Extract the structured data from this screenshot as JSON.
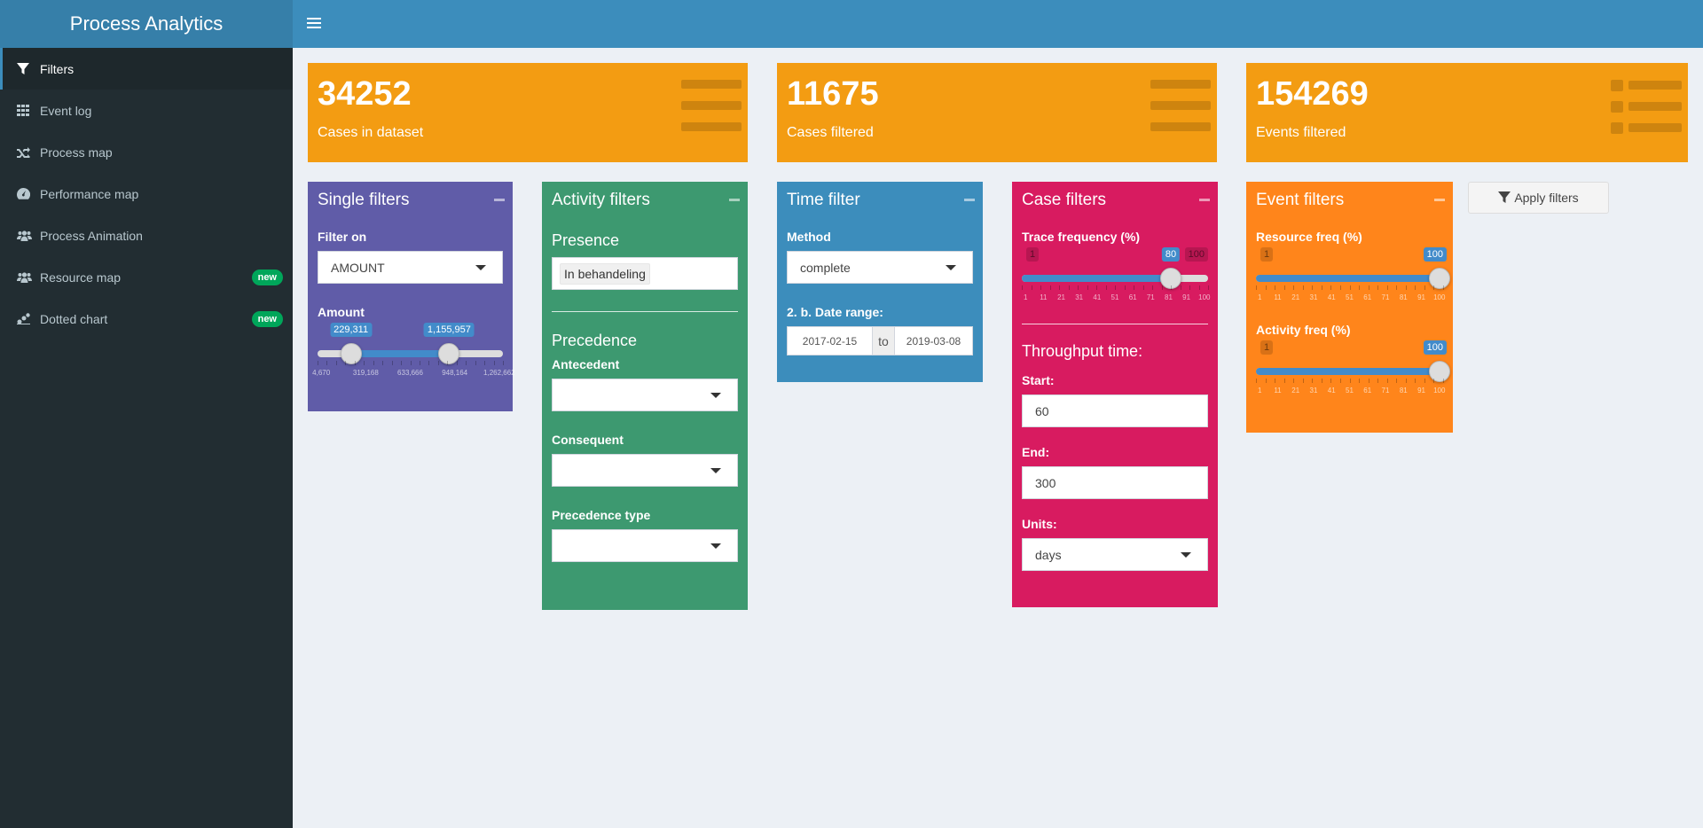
{
  "app": {
    "title": "Process Analytics"
  },
  "sidebar": {
    "items": [
      {
        "label": "Filters",
        "icon": "filter-icon"
      },
      {
        "label": "Event log",
        "icon": "grid-icon"
      },
      {
        "label": "Process map",
        "icon": "random-icon"
      },
      {
        "label": "Performance map",
        "icon": "dashboard-icon"
      },
      {
        "label": "Process Animation",
        "icon": "users-icon"
      },
      {
        "label": "Resource map",
        "icon": "users-icon",
        "badge": "new"
      },
      {
        "label": "Dotted chart",
        "icon": "dotted-chart-icon",
        "badge": "new"
      }
    ]
  },
  "stats": [
    {
      "value": "34252",
      "label": "Cases in dataset"
    },
    {
      "value": "11675",
      "label": "Cases filtered"
    },
    {
      "value": "154269",
      "label": "Events filtered"
    }
  ],
  "single_filters": {
    "title": "Single filters",
    "filter_on_label": "Filter on",
    "filter_on_value": "AMOUNT",
    "amount_label": "Amount",
    "slider": {
      "from_label": "229,311",
      "to_label": "1,155,957",
      "from_frac": 0.18,
      "to_frac": 0.71,
      "grid": [
        "4,670",
        "319,168",
        "633,666",
        "948,164",
        "1,262,662"
      ]
    }
  },
  "activity_filters": {
    "title": "Activity filters",
    "presence_heading": "Presence",
    "presence_tag": "In behandeling",
    "precedence_heading": "Precedence",
    "antecedent_label": "Antecedent",
    "consequent_label": "Consequent",
    "precedence_type_label": "Precedence type"
  },
  "time_filter": {
    "title": "Time filter",
    "method_label": "Method",
    "method_value": "complete",
    "date_range_label": "2. b. Date range:",
    "date_from": "2017-02-15",
    "date_sep": "to",
    "date_to": "2019-03-08"
  },
  "case_filters": {
    "title": "Case filters",
    "trace_label": "Trace frequency (%)",
    "trace_slider": {
      "min": "1",
      "max": "100",
      "value_label": "80",
      "value_frac": 0.8,
      "grid": [
        "1",
        "11",
        "21",
        "31",
        "41",
        "51",
        "61",
        "71",
        "81",
        "91",
        "100"
      ]
    },
    "throughput_heading": "Throughput time:",
    "start_label": "Start:",
    "start_value": "60",
    "end_label": "End:",
    "end_value": "300",
    "units_label": "Units:",
    "units_value": "days"
  },
  "event_filters": {
    "title": "Event filters",
    "resource_label": "Resource freq (%)",
    "resource_slider": {
      "min": "1",
      "value_label": "100",
      "value_frac": 1.0,
      "grid": [
        "1",
        "11",
        "21",
        "31",
        "41",
        "51",
        "61",
        "71",
        "81",
        "91",
        "100"
      ]
    },
    "activity_label": "Activity freq (%)",
    "activity_slider": {
      "min": "1",
      "value_label": "100",
      "value_frac": 1.0,
      "grid": [
        "1",
        "11",
        "21",
        "31",
        "41",
        "51",
        "61",
        "71",
        "81",
        "91",
        "100"
      ]
    }
  },
  "apply_button": {
    "label": "Apply filters"
  },
  "colors": {
    "purple": "#605ca8",
    "green": "#3d9970",
    "blue": "#3c8dbc",
    "pink": "#d81b60",
    "orange": "#ff851b",
    "yellow": "#f39c12"
  }
}
